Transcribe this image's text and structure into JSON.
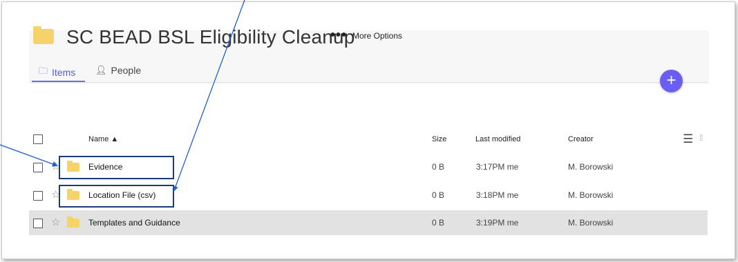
{
  "folder": {
    "title": "SC BEAD BSL Eligibility Cleanup",
    "more_dots": "•••",
    "more_label": "More Options"
  },
  "tabs": [
    {
      "label": "Items",
      "icon": "folder-outline-icon",
      "active": true
    },
    {
      "label": "People",
      "icon": "person-icon",
      "active": false
    }
  ],
  "fab": {
    "label": "+"
  },
  "table": {
    "columns": {
      "name": "Name ▲",
      "size": "Size",
      "modified": "Last modified",
      "creator": "Creator"
    },
    "rows": [
      {
        "name": "Evidence",
        "size": "0 B",
        "modified": "3:17PM me",
        "creator": "M. Borowski",
        "selected": false
      },
      {
        "name": "Location File (csv)",
        "size": "0 B",
        "modified": "3:18PM me",
        "creator": "M. Borowski",
        "selected": false
      },
      {
        "name": "Templates and Guidance",
        "size": "0 B",
        "modified": "3:19PM me",
        "creator": "M. Borowski",
        "selected": true
      }
    ]
  },
  "colors": {
    "accent": "#6a5ef5",
    "folder": "#f6d26b",
    "annotation": "#1b3a78",
    "arrow": "#1f5fd1",
    "selected_row": "#e2e2e2"
  }
}
